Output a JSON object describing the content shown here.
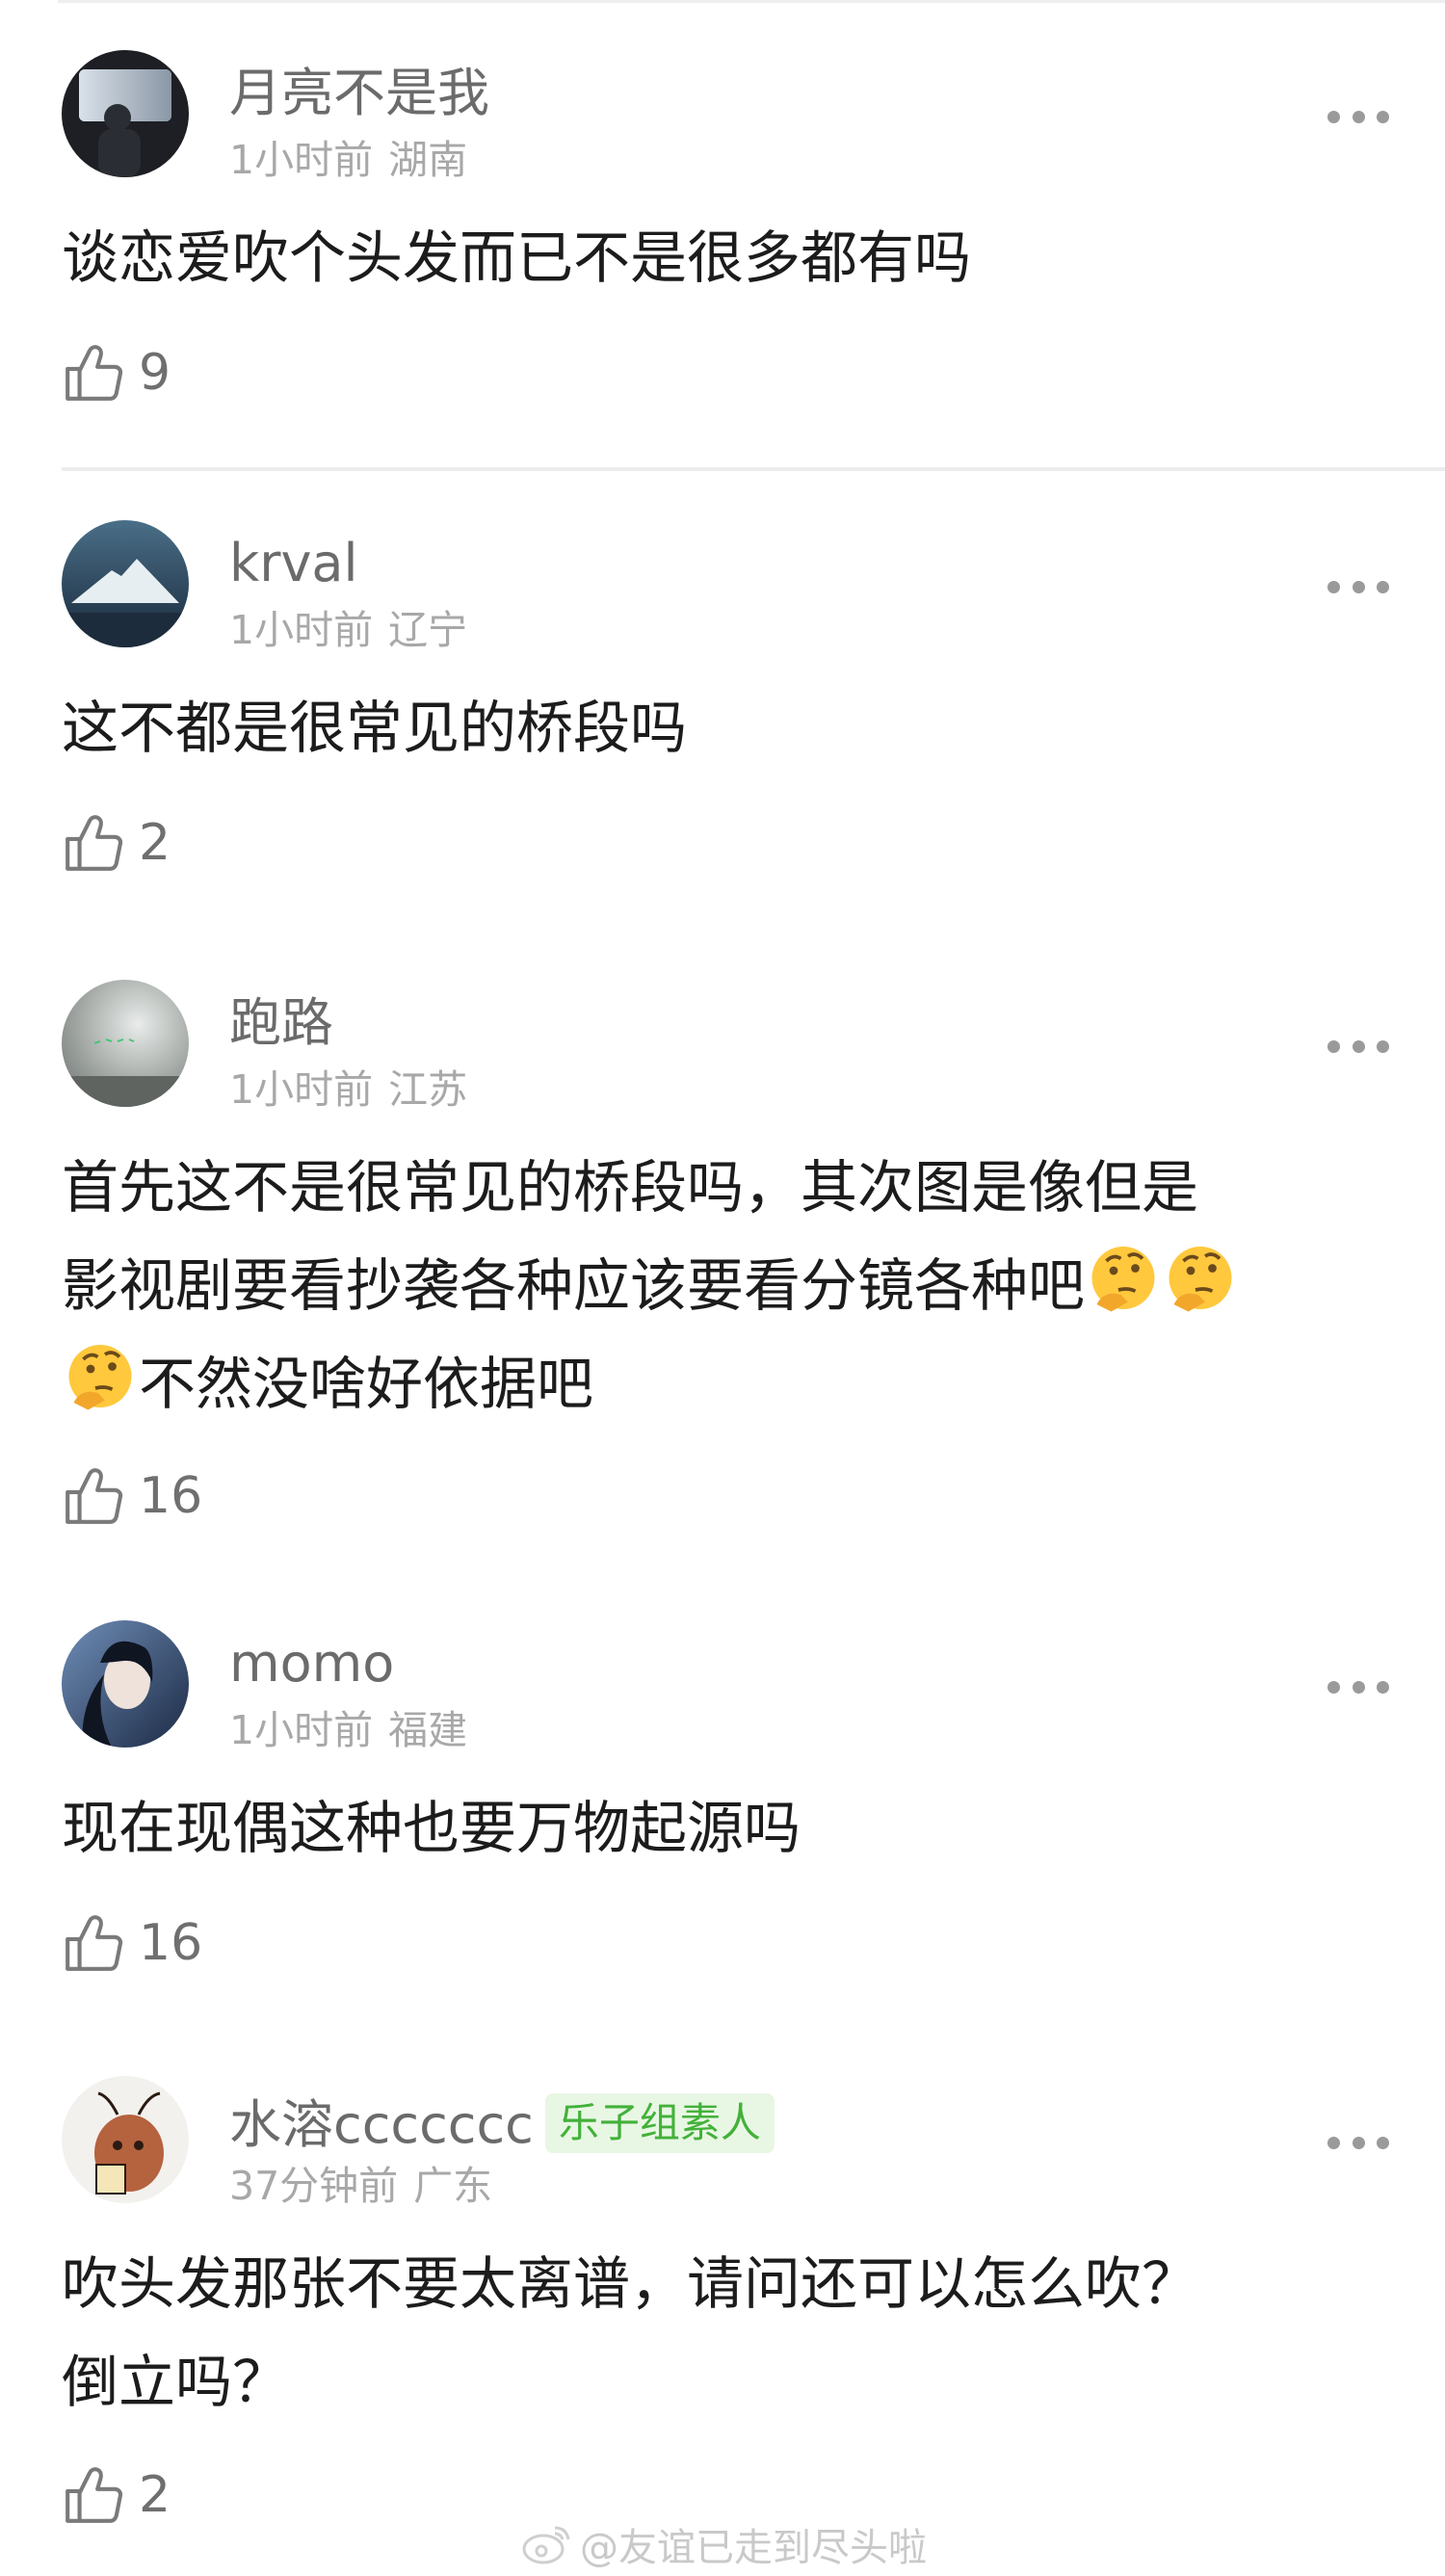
{
  "comments": [
    {
      "username": "月亮不是我",
      "time": "1小时前",
      "location": "湖南",
      "text": "谈恋爱吹个头发而已不是很多都有吗",
      "likes": "9"
    },
    {
      "username": "krval",
      "time": "1小时前",
      "location": "辽宁",
      "text": "这不都是很常见的桥段吗",
      "likes": "2"
    },
    {
      "username": "跑路",
      "time": "1小时前",
      "location": "江苏",
      "text_line1": "首先这不是很常见的桥段吗，其次图是像但是",
      "text_line2": "影视剧要看抄袭各种应该要看分镜各种吧",
      "text_line3": "不然没啥好依据吧",
      "likes": "16"
    },
    {
      "username": "momo",
      "time": "1小时前",
      "location": "福建",
      "text": "现在现偶这种也要万物起源吗",
      "likes": "16"
    },
    {
      "username": "水溶ccccccc",
      "badge": "乐子组素人",
      "time": "37分钟前",
      "location": "广东",
      "text_line1": "吹头发那张不要太离谱，请问还可以怎么吹？",
      "text_line2": "倒立吗？",
      "likes": "2"
    }
  ],
  "watermark": "@友谊已走到尽头啦",
  "icons": {
    "like": "thumbs-up-outline-icon",
    "more": "more-dots-icon",
    "emoji": "thinking-face-emoji",
    "weibo": "weibo-logo-icon"
  }
}
